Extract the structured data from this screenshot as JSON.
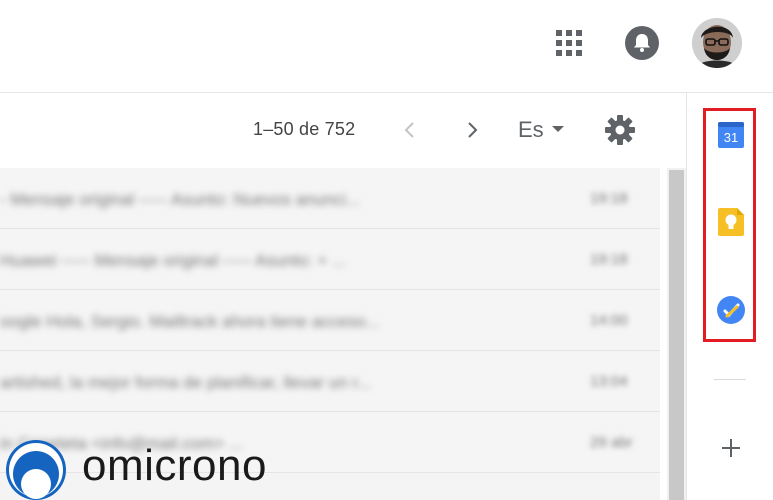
{
  "header": {
    "apps_icon": "apps-grid-icon",
    "notifications_icon": "bell-icon",
    "avatar_icon": "user-avatar"
  },
  "toolbar": {
    "pagination": "1–50 de 752",
    "prev_icon": "chevron-left-icon",
    "next_icon": "chevron-right-icon",
    "language": "Es",
    "settings_icon": "gear-icon"
  },
  "emails": [
    {
      "snippet": "- Mensaje original ----- Asunto: Nuevos anunci...",
      "time": "19:18"
    },
    {
      "snippet": "Huawei ----- Mensaje original ----- Asunto: + ...",
      "time": "19:18"
    },
    {
      "snippet": "oogle Hola, Sergio. Mailtrack ahora tiene acceso...",
      "time": "14:00"
    },
    {
      "snippet": "artished, la mejor forma de planificar, llevar un r...",
      "time": "13:04"
    },
    {
      "snippet": "in Coneteta <info@mail.com> ...",
      "time": "29 abr"
    }
  ],
  "side_panel": {
    "calendar_label": "31",
    "calendar_icon": "google-calendar-icon",
    "keep_icon": "google-keep-icon",
    "tasks_icon": "google-tasks-icon",
    "add_icon": "plus-icon",
    "highlight_color": "#e31b23"
  },
  "watermark": {
    "text": "omicrono"
  },
  "colors": {
    "icon_gray": "#5f6368",
    "calendar_blue": "#4285f4",
    "keep_yellow": "#f6bf26",
    "tasks_blue": "#4285f4"
  }
}
